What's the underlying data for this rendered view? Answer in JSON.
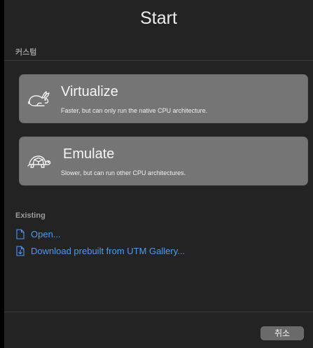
{
  "window": {
    "title": "Start"
  },
  "sections": {
    "custom_label": "커스텀",
    "existing_label": "Existing"
  },
  "options": [
    {
      "title": "Virtualize",
      "description": "Faster, but can only run the native CPU architecture.",
      "icon": "rabbit-icon"
    },
    {
      "title": "Emulate",
      "description": "Slower, but can run other CPU architectures.",
      "icon": "turtle-icon"
    }
  ],
  "existing_links": [
    {
      "label": "Open...",
      "icon": "document-icon"
    },
    {
      "label": "Download prebuilt from UTM Gallery...",
      "icon": "document-download-icon"
    }
  ],
  "footer": {
    "cancel_label": "취소"
  },
  "colors": {
    "background": "#232323",
    "card": "#757575",
    "link": "#4a9bf0"
  }
}
